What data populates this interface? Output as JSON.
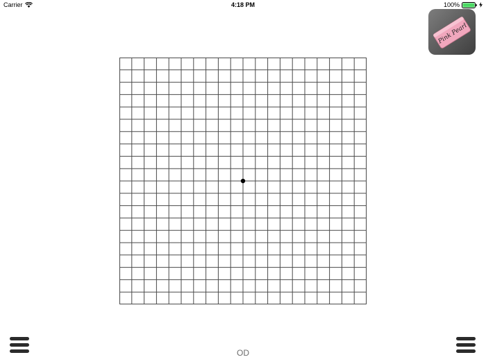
{
  "status_bar": {
    "carrier": "Carrier",
    "time": "4:18 PM",
    "battery_percent": "100%",
    "battery_level": 1.0,
    "battery_color": "#4cd964",
    "icons": [
      "wifi-icon",
      "battery-icon",
      "charging-bolt-icon"
    ]
  },
  "eraser_button": {
    "icon": "eraser-icon",
    "brand_text": "Pink Pearl",
    "eraser_color": "#f1a7bd"
  },
  "amsler_grid": {
    "divisions": 20,
    "line_color": "#4a4a4a",
    "fixation_dot_color": "#000000"
  },
  "menu": {
    "left_icon": "hamburger-menu-icon",
    "right_icon": "hamburger-menu-icon"
  },
  "eye_label": "OD"
}
